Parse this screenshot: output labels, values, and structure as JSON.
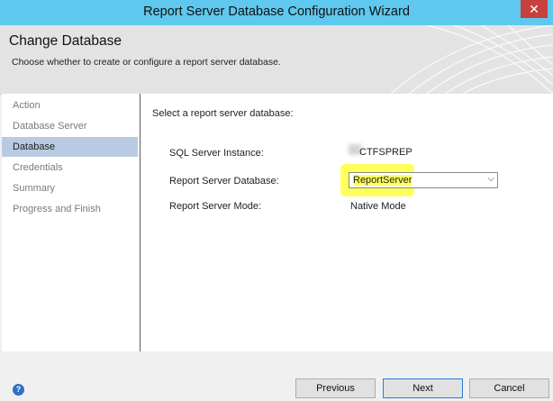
{
  "window": {
    "title": "Report Server Database Configuration Wizard",
    "close_glyph": "✕"
  },
  "header": {
    "title": "Change Database",
    "subtitle": "Choose whether to create or configure a report server database."
  },
  "nav": {
    "items": [
      {
        "label": "Action"
      },
      {
        "label": "Database Server"
      },
      {
        "label": "Database"
      },
      {
        "label": "Credentials"
      },
      {
        "label": "Summary"
      },
      {
        "label": "Progress and Finish"
      }
    ],
    "active_index": 2
  },
  "main": {
    "prompt": "Select a report server database:",
    "sql_instance_label": "SQL Server Instance:",
    "sql_instance_value": "CTFSPREP",
    "db_label": "Report Server Database:",
    "db_value": "ReportServer",
    "mode_label": "Report Server Mode:",
    "mode_value": "Native Mode"
  },
  "footer": {
    "help_glyph": "?",
    "previous": "Previous",
    "next": "Next",
    "cancel": "Cancel"
  },
  "colors": {
    "titlebar": "#5fc8ee",
    "highlight": "#ffff5c",
    "nav_active": "#b9cbe2",
    "close": "#c7413c"
  }
}
